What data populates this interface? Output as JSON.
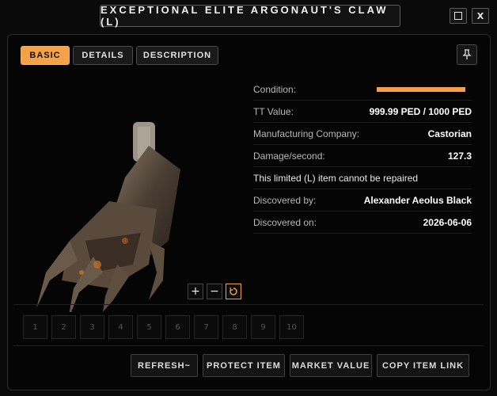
{
  "window": {
    "title": "EXCEPTIONAL ELITE ARGONAUT'S CLAW (L)",
    "maximize_icon": "square-icon",
    "close_label": "X"
  },
  "tabs": [
    {
      "label": "BASIC",
      "active": true
    },
    {
      "label": "DETAILS",
      "active": false
    },
    {
      "label": "DESCRIPTION",
      "active": false
    }
  ],
  "pin_icon": "pin-icon",
  "properties": {
    "condition_label": "Condition:",
    "condition_fraction": 0.9999,
    "tt_value_label": "TT Value:",
    "tt_value": "999.99 PED / 1000 PED",
    "manufacturer_label": "Manufacturing Company:",
    "manufacturer": "Castorian",
    "dps_label": "Damage/second:",
    "dps": "127.3",
    "repair_note": "This limited (L) item cannot be repaired",
    "discovered_by_label": "Discovered by:",
    "discovered_by": "Alexander Aeolus Black",
    "discovered_on_label": "Discovered on:",
    "discovered_on": "2026-06-06"
  },
  "zoom": {
    "plus": "+",
    "minus": "−",
    "reset_icon": "rotate-reset-icon"
  },
  "slots": [
    "1",
    "2",
    "3",
    "4",
    "5",
    "6",
    "7",
    "8",
    "9",
    "10"
  ],
  "actions": {
    "refresh": "REFRESH~",
    "protect": "PROTECT ITEM",
    "market": "MARKET VALUE",
    "copy_link": "COPY ITEM LINK"
  },
  "colors": {
    "accent": "#f4a24a",
    "background": "#0a0a0a"
  }
}
